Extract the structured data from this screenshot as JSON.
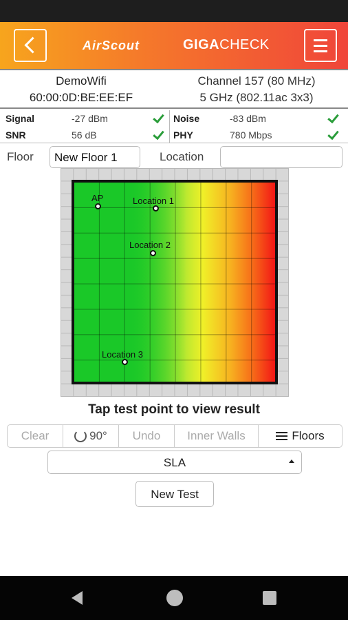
{
  "header": {
    "brand_left": "AirScout",
    "brand_right_bold": "GIGA",
    "brand_right": "CHECK"
  },
  "network": {
    "ssid": "DemoWifi",
    "mac": "60:00:0D:BE:EE:EF",
    "channel": "Channel 157 (80 MHz)",
    "band": "5 GHz (802.11ac 3x3)"
  },
  "stats": [
    {
      "label": "Signal",
      "value": "-27 dBm",
      "label2": "Noise",
      "value2": "-83 dBm"
    },
    {
      "label": "SNR",
      "value": "56 dB",
      "label2": "PHY",
      "value2": "780 Mbps"
    }
  ],
  "form": {
    "floor_label": "Floor",
    "floor_value": "New Floor 1",
    "location_label": "Location",
    "location_value": ""
  },
  "map": {
    "points": [
      "AP",
      "Location 1",
      "Location 2",
      "Location 3"
    ]
  },
  "hint": "Tap test point to view result",
  "toolbar": {
    "clear": "Clear",
    "rotate": "90°",
    "undo": "Undo",
    "inner_walls": "Inner Walls",
    "floors": "Floors"
  },
  "select": {
    "value": "SLA"
  },
  "new_test": "New Test",
  "colors": {
    "header_start": "#f7a51d",
    "header_end": "#f0453a",
    "ok": "#2a9d3a"
  }
}
